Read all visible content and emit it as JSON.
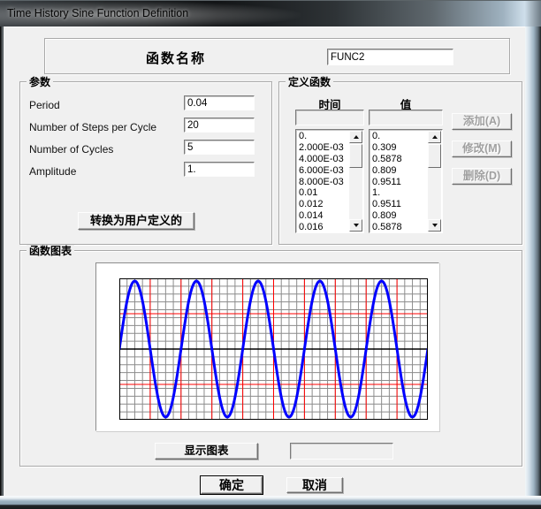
{
  "window": {
    "title": "Time History Sine Function Definition"
  },
  "name_section": {
    "label": "函数名称",
    "value": "FUNC2"
  },
  "parameters": {
    "title": "参数",
    "fields": [
      {
        "label": "Period",
        "value": "0.04"
      },
      {
        "label": "Number of Steps per Cycle",
        "value": "20"
      },
      {
        "label": "Number of Cycles",
        "value": "5"
      },
      {
        "label": "Amplitude",
        "value": "1."
      }
    ],
    "convert_button": "转换为用户定义的"
  },
  "define_function": {
    "title": "定义函数",
    "time_header": "时间",
    "value_header": "值",
    "time_input": "",
    "value_input": "",
    "time_items": [
      "0.",
      "2.000E-03",
      "4.000E-03",
      "6.000E-03",
      "8.000E-03",
      "0.01",
      "0.012",
      "0.014",
      "0.016"
    ],
    "value_items": [
      "0.",
      "0.309",
      "0.5878",
      "0.809",
      "0.9511",
      "1.",
      "0.9511",
      "0.809",
      "0.5878"
    ],
    "buttons": {
      "add": "添加(A)",
      "modify": "修改(M)",
      "delete": "删除(D)"
    }
  },
  "graph_section": {
    "title": "函数图表",
    "show_graph_button": "显示图表",
    "readout_value": ""
  },
  "footer": {
    "ok": "确定",
    "cancel": "取消"
  },
  "icons": {
    "scroll_up": "triangle-up",
    "scroll_down": "triangle-down"
  },
  "chart_data": {
    "type": "line",
    "title": "",
    "xlabel": "",
    "ylabel": "",
    "function": "amplitude * sin(2*pi*t / period)",
    "amplitude": 1,
    "period": 0.04,
    "cycles": 5,
    "steps_per_cycle": 20,
    "x_range": [
      0,
      0.2
    ],
    "y_range": [
      -1,
      1
    ],
    "grid": "on",
    "minor_x_spacing": 0.005,
    "minor_y_divisions": 18,
    "major_vline_spacing": 0.02,
    "major_hlines": [
      0.5,
      -0.5
    ],
    "curve_color": "#0000ff",
    "minor_grid_color": "#8c8c8c",
    "major_grid_color": "#ff0000",
    "axis_color": "#000000",
    "background": "#ffffff"
  }
}
